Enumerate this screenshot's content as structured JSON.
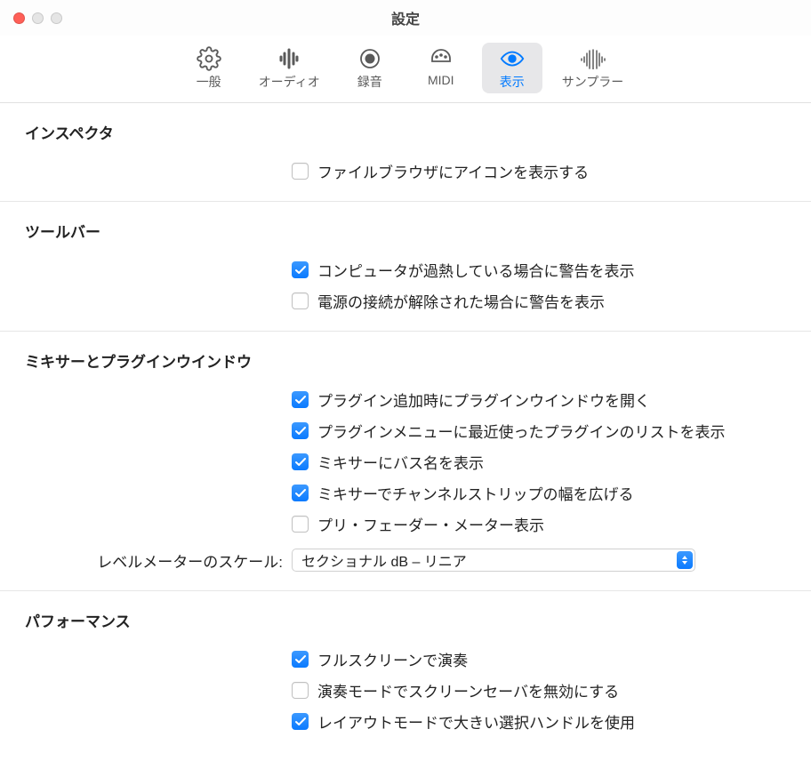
{
  "window": {
    "title": "設定"
  },
  "toolbar": {
    "items": [
      {
        "label": "一般"
      },
      {
        "label": "オーディオ"
      },
      {
        "label": "録音"
      },
      {
        "label": "MIDI"
      },
      {
        "label": "表示"
      },
      {
        "label": "サンプラー"
      }
    ],
    "selected_index": 4
  },
  "sections": {
    "inspector": {
      "title": "インスペクタ",
      "show_icons_label": "ファイルブラウザにアイコンを表示する",
      "show_icons_checked": false
    },
    "toolbar_section": {
      "title": "ツールバー",
      "overheat_label": "コンピュータが過熱している場合に警告を表示",
      "overheat_checked": true,
      "power_label": "電源の接続が解除された場合に警告を表示",
      "power_checked": false
    },
    "mixer": {
      "title": "ミキサーとプラグインウインドウ",
      "open_plugin_label": "プラグイン追加時にプラグインウインドウを開く",
      "open_plugin_checked": true,
      "recent_plugins_label": "プラグインメニューに最近使ったプラグインのリストを表示",
      "recent_plugins_checked": true,
      "bus_names_label": "ミキサーにバス名を表示",
      "bus_names_checked": true,
      "wide_strips_label": "ミキサーでチャンネルストリップの幅を広げる",
      "wide_strips_checked": true,
      "pre_fader_label": "プリ・フェーダー・メーター表示",
      "pre_fader_checked": false,
      "level_scale_label": "レベルメーターのスケール:",
      "level_scale_value": "セクショナル dB – リニア"
    },
    "performance": {
      "title": "パフォーマンス",
      "fullscreen_label": "フルスクリーンで演奏",
      "fullscreen_checked": true,
      "screensaver_label": "演奏モードでスクリーンセーバを無効にする",
      "screensaver_checked": false,
      "large_handles_label": "レイアウトモードで大きい選択ハンドルを使用",
      "large_handles_checked": true
    }
  }
}
